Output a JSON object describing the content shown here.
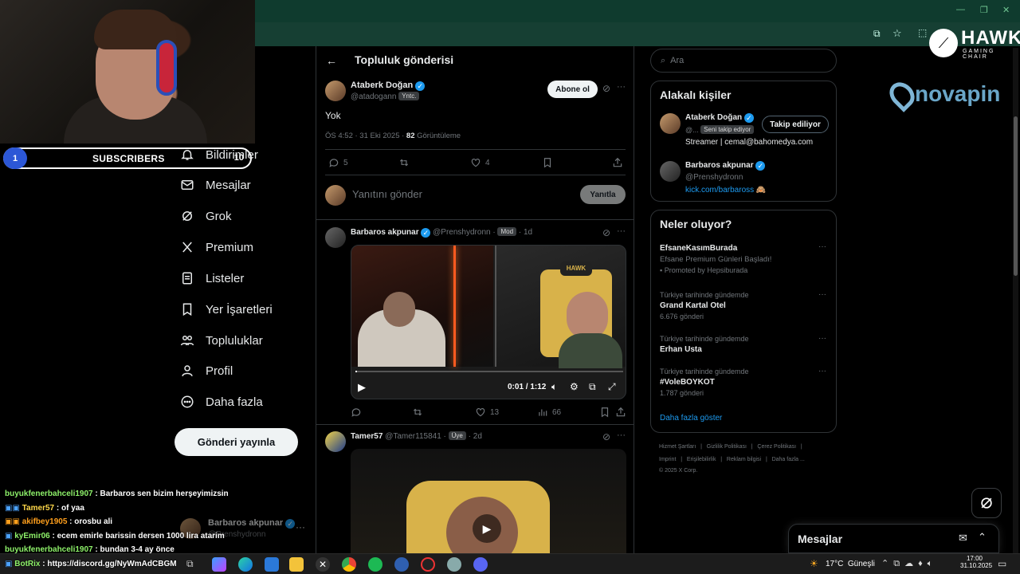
{
  "stream": {
    "subscribers_label": "SUBSCRIBERS",
    "subscribers_count": "1",
    "subscribers_goal": "10",
    "sponsor_hawk": "HAWK",
    "sponsor_hawk_sub": "GAMING CHAIR",
    "sponsor_novapin": "novapin",
    "chat": [
      {
        "user": "buyukfenerbahceli1907",
        "text": " : Barbaros sen bizim herşeyimizsin"
      },
      {
        "user": "Tamer57",
        "text": " : of yaa"
      },
      {
        "user": "akifbey1905",
        "text": " : orosbu ali"
      },
      {
        "user": "kyEmir06",
        "text": " : ecem emirle barissin dersen 1000 lira atarim"
      },
      {
        "user": "buyukfenerbahceli1907",
        "text": " : bundan 3-4 ay önce"
      },
      {
        "user": "BotRix",
        "text": " : https://discord.gg/NyWmAdCBGM"
      }
    ]
  },
  "nav": {
    "items": [
      "Bildirimler",
      "Mesajlar",
      "Grok",
      "Premium",
      "Listeler",
      "Yer İşaretleri",
      "Topluluklar",
      "Profil",
      "Daha fazla"
    ],
    "post_button": "Gönderi yayınla",
    "account_name": "Barbaros akpunar",
    "account_handle": "@Prenshydronn"
  },
  "main": {
    "header_title": "Topluluk gönderisi",
    "post": {
      "author": "Ataberk Doğan",
      "handle": "@atadogann",
      "badge": "Yntc.",
      "subscribe": "Abone ol",
      "text": "Yok",
      "time": "ÖS 4:52 · 31 Eki 2025 · ",
      "views": "82",
      "views_label": " Görüntüleme",
      "replies": "5",
      "likes": "4"
    },
    "reply": {
      "placeholder": "Yanıtını gönder",
      "button": "Yanıtla"
    },
    "reply1": {
      "author": "Barbaros akpunar",
      "handle": "@Prenshydronn",
      "badge": "Mod",
      "age": "1d",
      "video_time": "0:01 / 1:12",
      "comments": "",
      "likes": "13",
      "views": "66"
    },
    "reply2": {
      "author": "Tamer57",
      "handle": "@Tamer115841",
      "badge": "Üye",
      "age": "2d"
    }
  },
  "right": {
    "search_placeholder": "Ara",
    "related_title": "Alakalı kişiler",
    "related": [
      {
        "name": "Ataberk Doğan",
        "handle": "@...",
        "tag": "Seni takip ediyor",
        "button": "Takip ediliyor",
        "bio": "Streamer | cemal@bahomedya.com"
      },
      {
        "name": "Barbaros akpunar",
        "handle": "@Prenshydronn",
        "link": "kick.com/barbaross 🙈"
      }
    ],
    "trends_title": "Neler oluyor?",
    "trends": [
      {
        "meta": "",
        "title": "EfsaneKasımBurada",
        "sub": "Efsane Premium Günleri Başladı!",
        "promo": "Promoted by Hepsiburada"
      },
      {
        "meta": "Türkiye tarihinde gündemde",
        "title": "Grand Kartal Otel",
        "sub": "6.676 gönderi"
      },
      {
        "meta": "Türkiye tarihinde gündemde",
        "title": "Erhan Usta",
        "sub": ""
      },
      {
        "meta": "Türkiye tarihinde gündemde",
        "title": "#VoleBOYKOT",
        "sub": "1.787 gönderi"
      }
    ],
    "show_more": "Daha fazla göster",
    "footer1": "Hizmet Şartları   |   Gizlilik Politikası   |   Çerez Politikası   |",
    "footer2": "Imprint   |   Erişilebilirlik   |   Reklam bilgisi   |   Daha fazla ...",
    "footer3": "© 2025 X Corp.",
    "messages": "Mesajlar"
  },
  "taskbar": {
    "weather": "17°C  Güneşli",
    "time": "17:00",
    "date": "31.10.2025"
  },
  "colors": {
    "accent": "#1d9bf0",
    "bg": "#000000",
    "chrome": "#0f3b2e"
  }
}
